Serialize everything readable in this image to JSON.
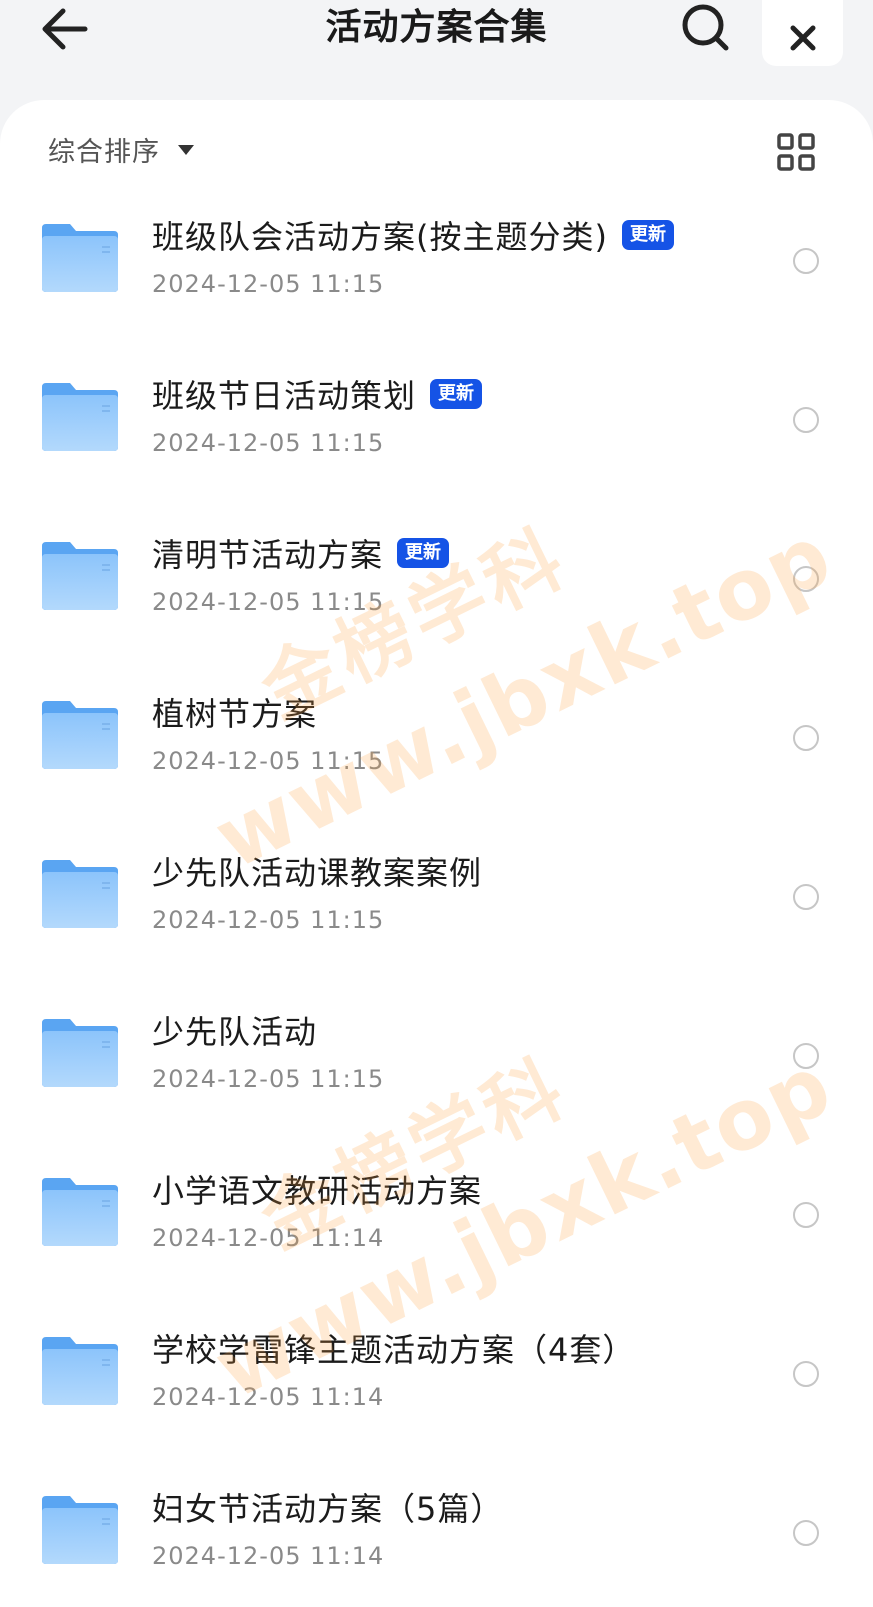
{
  "header": {
    "title": "活动方案合集",
    "back_icon": "arrow-left-icon",
    "search_icon": "search-icon",
    "close_icon": "close-icon"
  },
  "toolbar": {
    "sort_label": "综合排序",
    "grid_icon": "grid-view-icon"
  },
  "badge_label": "更新",
  "colors": {
    "badge": "#1553e6",
    "folder_light": "#8cc4fb",
    "folder_dark": "#5aa5f2",
    "watermark": "#ffa03c"
  },
  "items": [
    {
      "name": "班级队会活动方案(按主题分类)",
      "date": "2024-12-05 11:15",
      "badge": "更新"
    },
    {
      "name": "班级节日活动策划",
      "date": "2024-12-05 11:15",
      "badge": "更新"
    },
    {
      "name": "清明节活动方案",
      "date": "2024-12-05 11:15",
      "badge": "更新"
    },
    {
      "name": "植树节方案",
      "date": "2024-12-05 11:15"
    },
    {
      "name": "少先队活动课教案案例",
      "date": "2024-12-05 11:15"
    },
    {
      "name": "少先队活动",
      "date": "2024-12-05 11:15"
    },
    {
      "name": "小学语文教研活动方案",
      "date": "2024-12-05 11:14"
    },
    {
      "name": "学校学雷锋主题活动方案（4套）",
      "date": "2024-12-05 11:14"
    },
    {
      "name": "妇女节活动方案（5篇）",
      "date": "2024-12-05 11:14"
    }
  ],
  "watermark": {
    "brand": "金榜学科",
    "url": "www.jbxk.top"
  }
}
